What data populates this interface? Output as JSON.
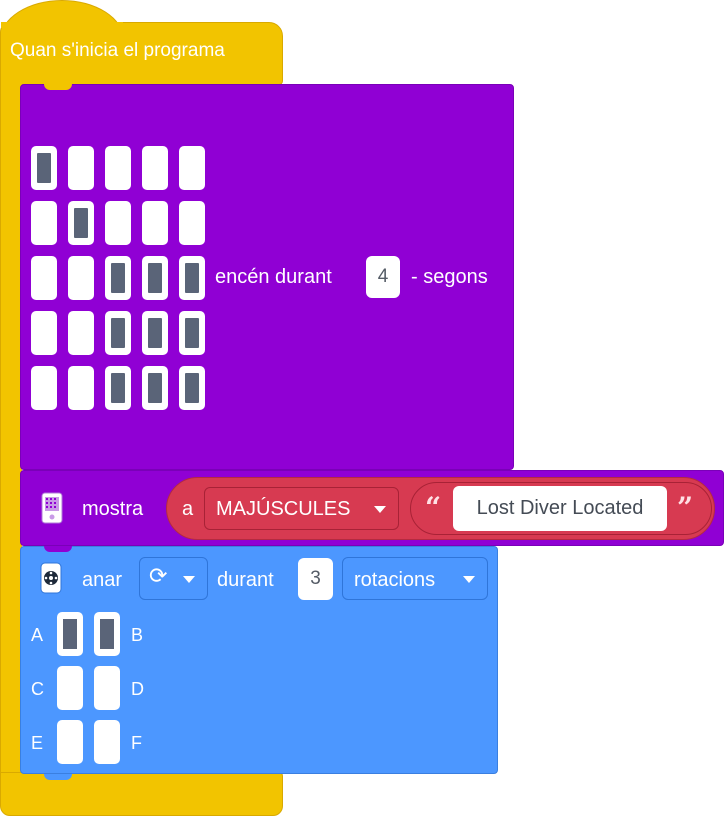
{
  "hat": {
    "title": "Quan s'inicia el programa"
  },
  "matrix_block": {
    "leds": [
      [
        1,
        0,
        0,
        0,
        0
      ],
      [
        0,
        1,
        0,
        0,
        0
      ],
      [
        0,
        0,
        1,
        1,
        1
      ],
      [
        0,
        0,
        1,
        1,
        1
      ],
      [
        0,
        0,
        1,
        1,
        1
      ]
    ],
    "label_on": "encén durant",
    "duration": "4",
    "label_unit": "- segons"
  },
  "show_block": {
    "label": "mostra",
    "a_label": "a",
    "case_option": "MAJÚSCULES",
    "open_quote": "“",
    "text": "Lost Diver Located",
    "close_quote": "”"
  },
  "motor_block": {
    "label": "anar",
    "direction_icon": "rotate-clockwise-icon",
    "direction_glyph": "⟳",
    "during_label": "durant",
    "amount": "3",
    "unit": "rotacions",
    "ports": [
      {
        "left": "A",
        "right": "B",
        "left_on": true,
        "right_on": true
      },
      {
        "left": "C",
        "right": "D",
        "left_on": false,
        "right_on": false
      },
      {
        "left": "E",
        "right": "F",
        "left_on": false,
        "right_on": false
      }
    ]
  },
  "colors": {
    "hat": "#f2c400",
    "looks": "#9000d4",
    "operator": "#d73a51",
    "motion": "#4c97ff"
  }
}
